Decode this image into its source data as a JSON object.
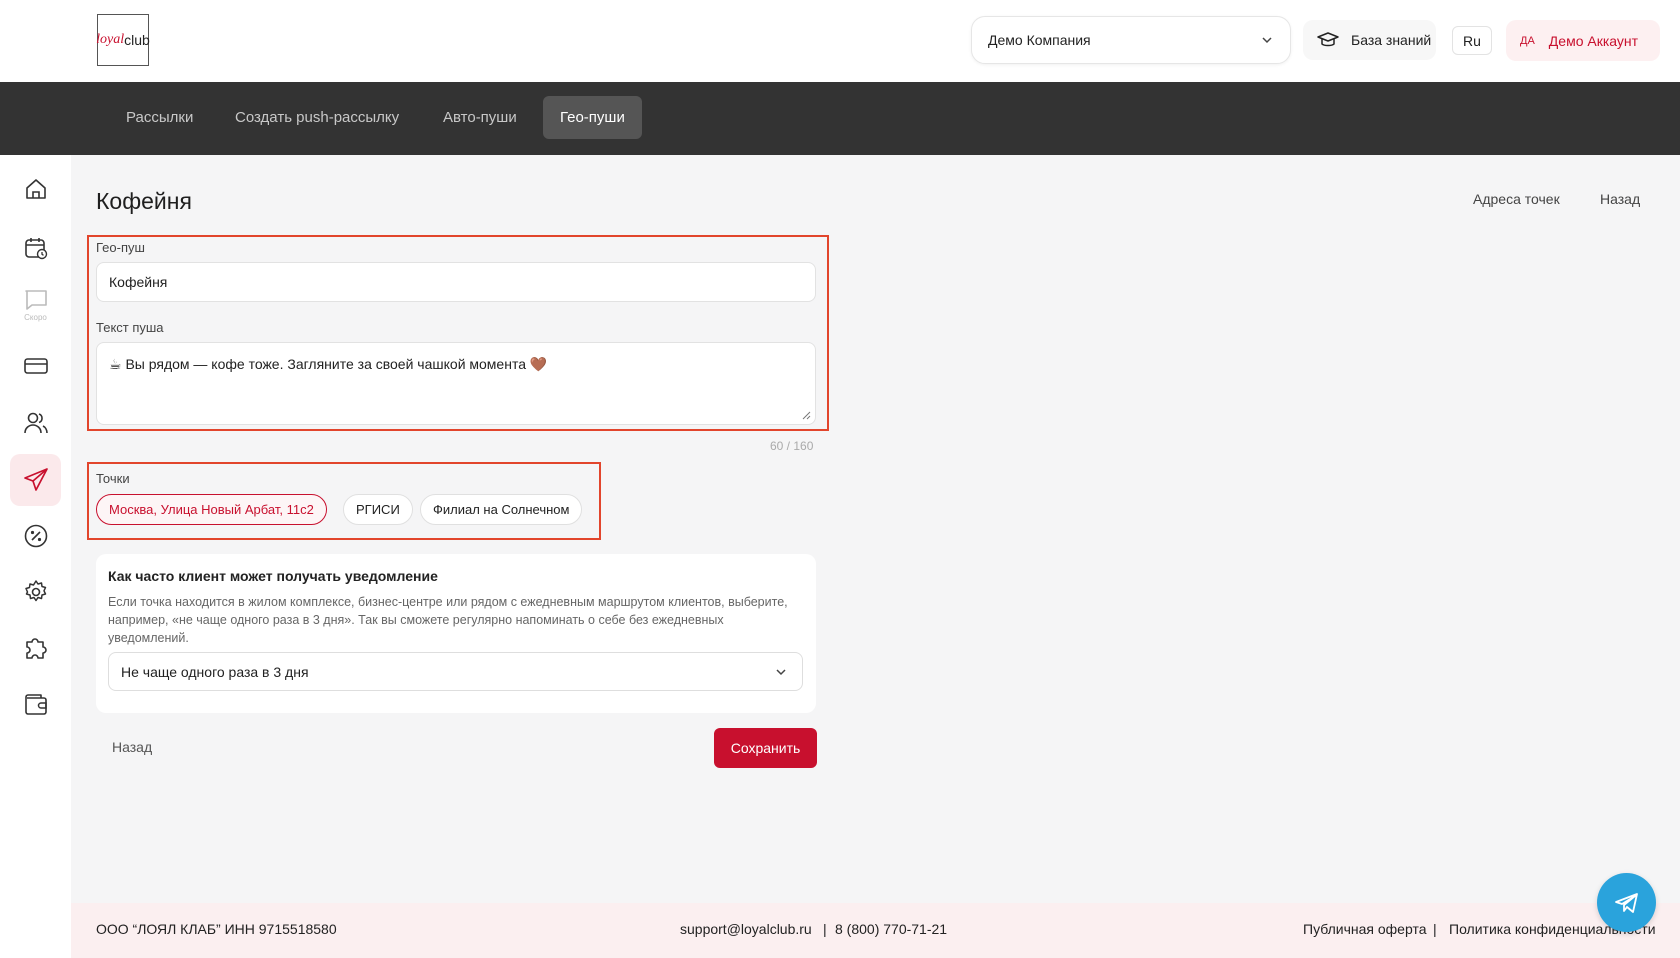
{
  "header": {
    "logo": {
      "part1": "loyal",
      "part2": "club"
    },
    "company_select": {
      "value": "Демо Компания"
    },
    "knowledge_base": "База знаний",
    "language": "Ru",
    "account": {
      "initials": "ДА",
      "name": "Демо Аккаунт"
    }
  },
  "nav": {
    "tabs": [
      {
        "label": "Рассылки",
        "active": false
      },
      {
        "label": "Создать push-рассылку",
        "active": false
      },
      {
        "label": "Авто-пуши",
        "active": false
      },
      {
        "label": "Гео-пуши",
        "active": true
      }
    ]
  },
  "sidebar": {
    "items": [
      {
        "icon": "home-icon"
      },
      {
        "icon": "calendar-icon"
      },
      {
        "icon": "chat-icon",
        "note": "Скоро"
      },
      {
        "icon": "card-icon"
      },
      {
        "icon": "users-icon"
      },
      {
        "icon": "send-icon",
        "active": true
      },
      {
        "icon": "discount-icon"
      },
      {
        "icon": "gear-icon"
      },
      {
        "icon": "puzzle-icon"
      },
      {
        "icon": "wallet-icon"
      }
    ]
  },
  "page": {
    "title": "Кофейня",
    "links": {
      "addresses": "Адреса точек",
      "back": "Назад"
    }
  },
  "form": {
    "geo_push": {
      "label": "Гео-пуш",
      "value": "Кофейня"
    },
    "push_text": {
      "label": "Текст пуша",
      "value": "☕ Вы рядом — кофе тоже. Загляните за своей чашкой момента 🤎",
      "counter": "60 / 160"
    },
    "points": {
      "label": "Точки",
      "chips": [
        {
          "label": "Москва, Улица Новый Арбат, 11с2",
          "selected": true
        },
        {
          "label": "РГИСИ",
          "selected": false
        },
        {
          "label": "Филиал на Солнечном",
          "selected": false
        }
      ]
    },
    "frequency": {
      "title": "Как часто клиент может получать уведомление",
      "description": "Если точка находится в жилом комплексе, бизнес-центре или рядом с ежедневным маршрутом клиентов, выберите, например, «не чаще одного раза в 3 дня». Так вы сможете регулярно напоминать о себе без ежедневных уведомлений.",
      "selected": "Не чаще одного раза в 3 дня"
    },
    "back_label": "Назад",
    "save_label": "Сохранить"
  },
  "footer": {
    "company": "ООО “ЛОЯЛ КЛАБ” ИНН 9715518580",
    "email": "support@loyalclub.ru",
    "separator": "|",
    "phone": "8 (800) 770-71-21",
    "offer": "Публичная оферта",
    "privacy": "Политика конфиденциальности"
  },
  "colors": {
    "accent": "#c8102e",
    "nav_bg": "#333333",
    "highlight_frame": "#e2452c",
    "telegram": "#2aa3dc"
  }
}
